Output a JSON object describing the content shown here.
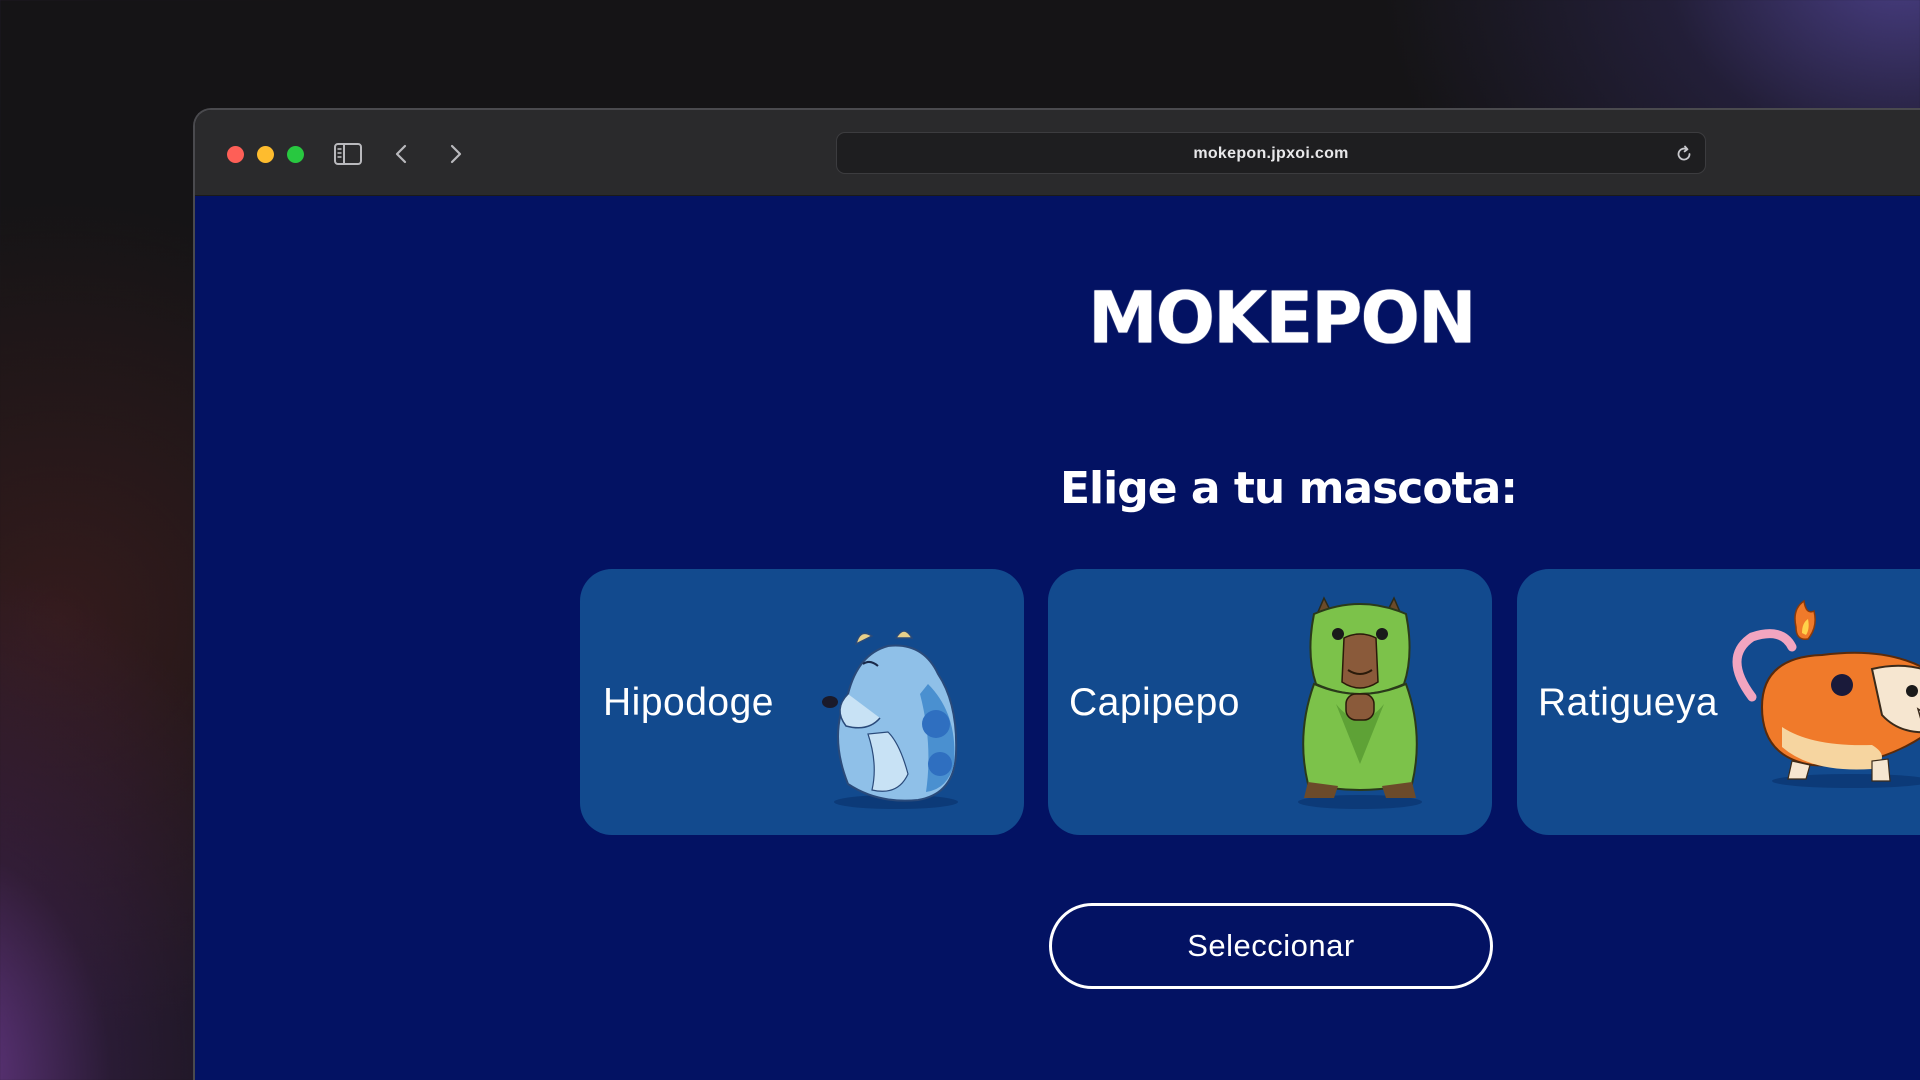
{
  "browser": {
    "url": "mokepon.jpxoi.com"
  },
  "page": {
    "logo": "MOKEPON",
    "subtitle": "Elige a tu mascota:",
    "pets": [
      {
        "name": "Hipodoge",
        "icon": "blue-hippo-creature"
      },
      {
        "name": "Capipepo",
        "icon": "green-capybara-creature"
      },
      {
        "name": "Ratigueya",
        "icon": "orange-fire-rat-creature"
      }
    ],
    "select_label": "Seleccionar"
  },
  "colors": {
    "page_bg": "#031263",
    "card_bg": "#124a8e",
    "toolbar_bg": "#2a2a2c"
  }
}
